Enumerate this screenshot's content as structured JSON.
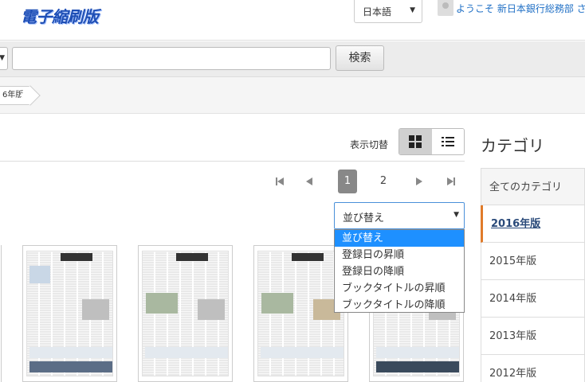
{
  "header": {
    "logo_text": "電子縮刷版",
    "language": "日本語",
    "welcome_text": "ようこそ 新日本銀行総務部 さ"
  },
  "search": {
    "query": "",
    "button_label": "検索"
  },
  "breadcrumb": {
    "current": "6年版"
  },
  "view": {
    "label": "表示切替",
    "mode": "grid"
  },
  "pagination": {
    "pages": [
      "1",
      "2"
    ],
    "current": "1"
  },
  "sort": {
    "selected": "並び替え",
    "options": [
      "並び替え",
      "登録日の昇順",
      "登録日の降順",
      "ブックタイトルの昇順",
      "ブックタイトルの降順"
    ],
    "highlighted": "並び替え"
  },
  "category": {
    "title": "カテゴリ",
    "items": [
      "全てのカテゴリ",
      "2016年版",
      "2015年版",
      "2014年版",
      "2013年版",
      "2012年版"
    ],
    "active": "2016年版"
  },
  "colors": {
    "accent": "#1e90ff",
    "active_category_marker": "#e07b2a",
    "logo": "#1f4fb5"
  }
}
